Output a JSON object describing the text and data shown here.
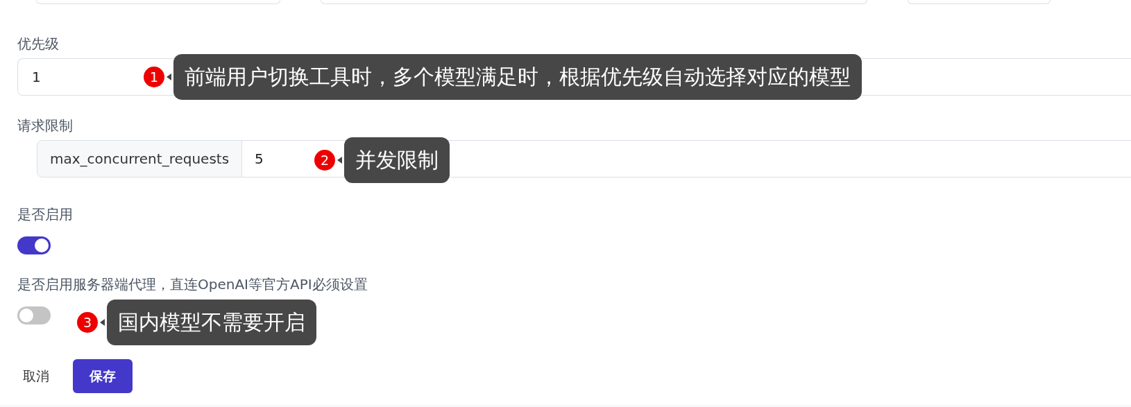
{
  "fields": [
    {
      "kind": "input",
      "label": "优先级",
      "value": "1",
      "annotation": {
        "number": "1",
        "text": "前端用户切换工具时，多个模型满足时，根据优先级自动选择对应的模型"
      }
    },
    {
      "kind": "addon_input",
      "label": "请求限制",
      "addon": "max_concurrent_requests",
      "value": "5",
      "annotation": {
        "number": "2",
        "text": "并发限制"
      }
    },
    {
      "kind": "switch",
      "label": "是否启用",
      "on": true
    },
    {
      "kind": "switch",
      "label": "是否启用服务器端代理，直连OpenAI等官方API必须设置",
      "on": false,
      "annotation": {
        "number": "3",
        "text": "国内模型不需要开启"
      }
    }
  ],
  "buttons": [
    {
      "kind": "text",
      "label": "取消"
    },
    {
      "kind": "primary",
      "label": "保存"
    }
  ]
}
